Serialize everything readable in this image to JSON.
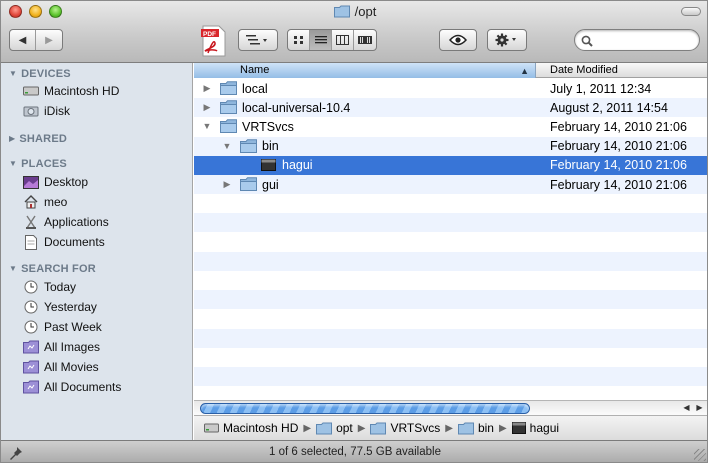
{
  "window": {
    "title": "/opt"
  },
  "toolbar": {
    "back_label": "◀",
    "forward_label": "▶",
    "search": {
      "placeholder": "",
      "value": ""
    }
  },
  "sidebar": {
    "sections": [
      {
        "label": "DEVICES",
        "items": [
          {
            "label": "Macintosh HD",
            "icon": "hard-drive-icon"
          },
          {
            "label": "iDisk",
            "icon": "idisk-icon"
          }
        ]
      },
      {
        "label": "SHARED",
        "items": []
      },
      {
        "label": "PLACES",
        "items": [
          {
            "label": "Desktop",
            "icon": "desktop-icon"
          },
          {
            "label": "meo",
            "icon": "home-icon"
          },
          {
            "label": "Applications",
            "icon": "applications-icon"
          },
          {
            "label": "Documents",
            "icon": "documents-icon"
          }
        ]
      },
      {
        "label": "SEARCH FOR",
        "items": [
          {
            "label": "Today",
            "icon": "clock-icon"
          },
          {
            "label": "Yesterday",
            "icon": "clock-icon"
          },
          {
            "label": "Past Week",
            "icon": "clock-icon"
          },
          {
            "label": "All Images",
            "icon": "smart-folder-icon"
          },
          {
            "label": "All Movies",
            "icon": "smart-folder-icon"
          },
          {
            "label": "All Documents",
            "icon": "smart-folder-icon"
          }
        ]
      }
    ]
  },
  "list": {
    "columns": {
      "name": "Name",
      "date": "Date Modified"
    },
    "rows": [
      {
        "name": "local",
        "date": "July 1, 2011 12:34",
        "level": 0,
        "expanded": false,
        "kind": "folder",
        "selected": false
      },
      {
        "name": "local-universal-10.4",
        "date": "August 2, 2011 14:54",
        "level": 0,
        "expanded": false,
        "kind": "folder",
        "selected": false
      },
      {
        "name": "VRTSvcs",
        "date": "February 14, 2010 21:06",
        "level": 0,
        "expanded": true,
        "kind": "folder",
        "selected": false
      },
      {
        "name": "bin",
        "date": "February 14, 2010 21:06",
        "level": 1,
        "expanded": true,
        "kind": "folder",
        "selected": false
      },
      {
        "name": "hagui",
        "date": "February 14, 2010 21:06",
        "level": 2,
        "expanded": null,
        "kind": "executable",
        "selected": true
      },
      {
        "name": "gui",
        "date": "February 14, 2010 21:06",
        "level": 1,
        "expanded": false,
        "kind": "folder",
        "selected": false
      }
    ]
  },
  "pathbar": {
    "crumbs": [
      {
        "label": "Macintosh HD",
        "icon": "hard-drive-icon"
      },
      {
        "label": "opt",
        "icon": "folder-icon"
      },
      {
        "label": "VRTSvcs",
        "icon": "folder-icon"
      },
      {
        "label": "bin",
        "icon": "folder-icon"
      },
      {
        "label": "hagui",
        "icon": "executable-icon"
      }
    ]
  },
  "status": {
    "text": "1 of 6 selected, 77.5 GB available"
  },
  "colors": {
    "selection": "#3875d7",
    "sidebar_bg": "#dde4ec",
    "header_active": "#94bde6",
    "folder": "#8fb6dc"
  }
}
